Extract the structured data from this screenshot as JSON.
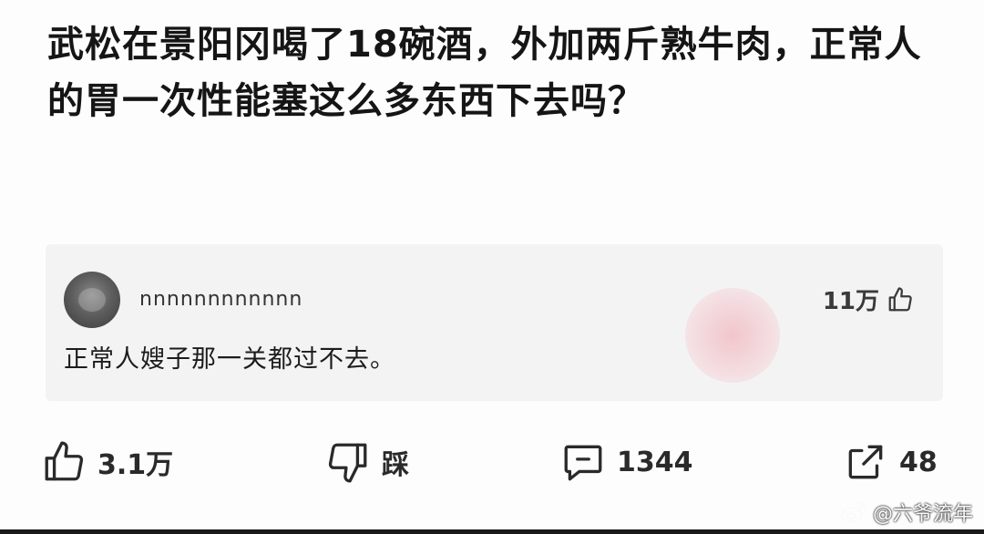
{
  "post": {
    "question": "武松在景阳冈喝了18碗酒，外加两斤熟牛肉，正常人的胃一次性能塞这么多东西下去吗？"
  },
  "top_comment": {
    "username": "nnnnnnnnnnnn",
    "text": "正常人嫂子那一关都过不去。",
    "likes": "11万",
    "like_icon": "thumbs-up-icon"
  },
  "actions": {
    "like": {
      "label": "3.1万",
      "icon": "thumbs-up-icon"
    },
    "dislike": {
      "label": "踩",
      "icon": "thumbs-down-icon"
    },
    "comment": {
      "label": "1344",
      "icon": "comment-icon"
    },
    "share": {
      "label": "48",
      "icon": "share-icon"
    }
  },
  "source_watermark": {
    "text": "@六爷流年",
    "icon": "weibo-icon"
  },
  "colors": {
    "text": "#151515",
    "card_background": "#f3f3f3",
    "page_background": "#fdfdfd"
  }
}
